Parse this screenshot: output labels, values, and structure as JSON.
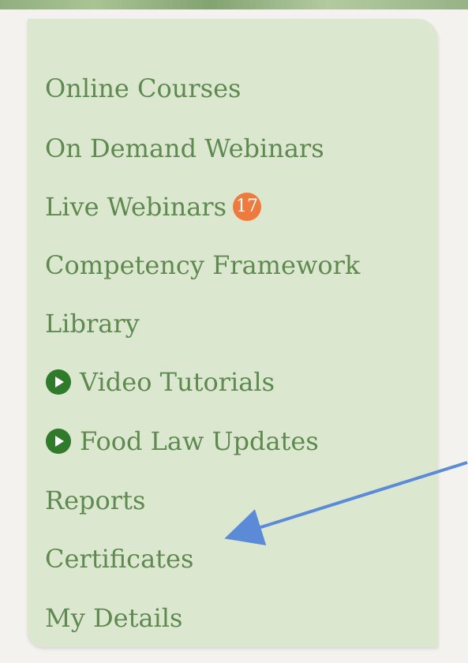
{
  "menu": {
    "items": [
      {
        "label": "Online Courses"
      },
      {
        "label": "On Demand Webinars"
      },
      {
        "label": "Live Webinars",
        "badge": "17"
      },
      {
        "label": "Competency Framework"
      },
      {
        "label": "Library"
      },
      {
        "label": "Video Tutorials",
        "icon": "play-icon"
      },
      {
        "label": "Food Law Updates",
        "icon": "play-icon"
      },
      {
        "label": "Reports"
      },
      {
        "label": "Certificates"
      },
      {
        "label": "My Details"
      }
    ]
  },
  "colors": {
    "panel_background": "#dbe7cf",
    "menu_text": "#5e8a4f",
    "badge": "#ef7a3e",
    "play_icon": "#2f7a2b",
    "annotation_arrow": "#5b8bd6"
  }
}
